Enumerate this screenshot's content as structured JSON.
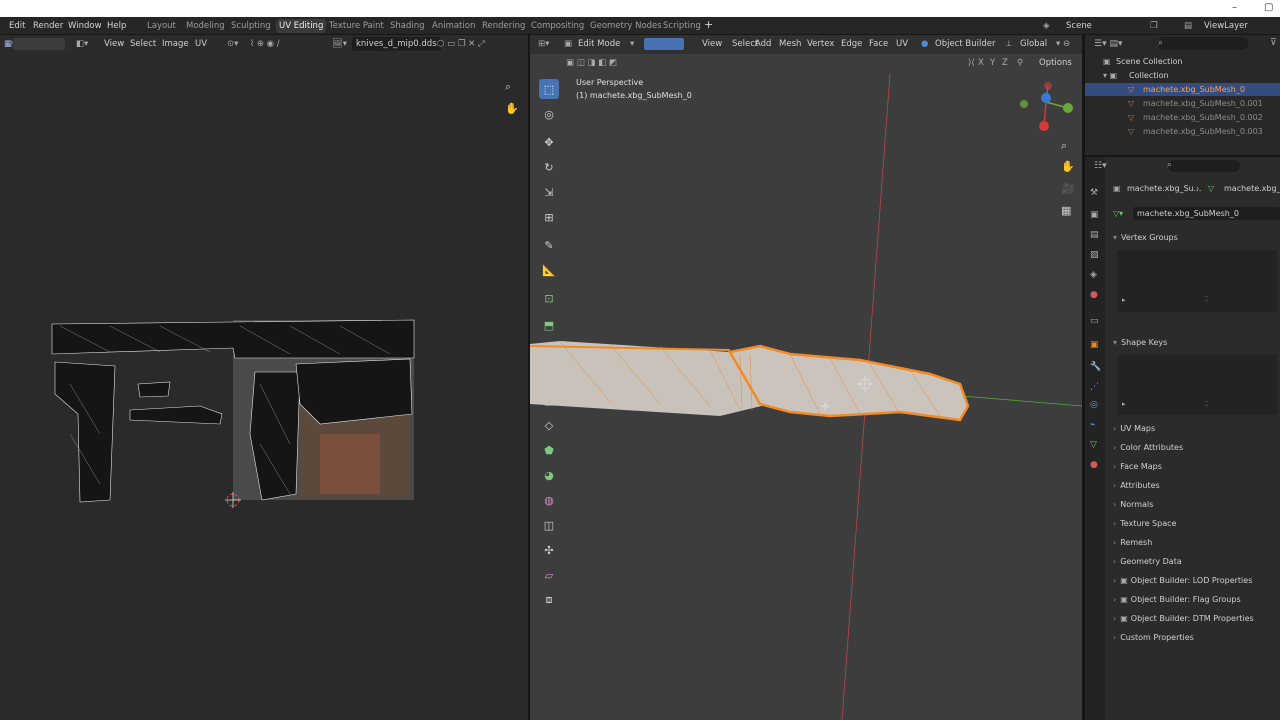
{
  "menus": [
    "Edit",
    "Render",
    "Window",
    "Help"
  ],
  "workspaces": [
    "Layout",
    "Modeling",
    "Sculpting",
    "UV Editing",
    "Texture Paint",
    "Shading",
    "Animation",
    "Rendering",
    "Compositing",
    "Geometry Nodes",
    "Scripting"
  ],
  "active_workspace": "UV Editing",
  "scene": {
    "label": "Scene"
  },
  "view_layer": {
    "label": "ViewLayer"
  },
  "uv_editor": {
    "menus": [
      "View",
      "Select",
      "Image",
      "UV"
    ],
    "image_name": "knives_d_mip0.dds"
  },
  "viewport": {
    "mode": "Edit Mode",
    "menus": [
      "View",
      "Select",
      "Add",
      "Mesh",
      "Vertex",
      "Edge",
      "Face",
      "UV"
    ],
    "object_builder": "Object Builder",
    "orientation": "Global",
    "options_label": "Options",
    "view_name": "User Perspective",
    "object_name": "(1) machete.xbg_SubMesh_0",
    "axes": [
      "X",
      "Y",
      "Z"
    ]
  },
  "outliner": {
    "scene_collection": "Scene Collection",
    "collection": "Collection",
    "items": [
      "machete.xbg_SubMesh_0",
      "machete.xbg_SubMesh_0.001",
      "machete.xbg_SubMesh_0.002",
      "machete.xbg_SubMesh_0.003"
    ]
  },
  "properties": {
    "breadcrumb_object": "machete.xbg_Su...",
    "breadcrumb_data": "machete.xbg_S",
    "mesh_name": "machete.xbg_SubMesh_0",
    "vertex_groups": "Vertex Groups",
    "shape_keys": "Shape Keys",
    "panels": [
      "UV Maps",
      "Color Attributes",
      "Face Maps",
      "Attributes",
      "Normals",
      "Texture Space",
      "Remesh",
      "Geometry Data",
      "Object Builder: LOD Properties",
      "Object Builder: Flag Groups",
      "Object Builder: DTM Properties",
      "Custom Properties"
    ]
  },
  "colors": {
    "accent": "#4772b3",
    "selection": "#f28a26",
    "x_axis": "#d43a3a",
    "y_axis": "#6aa83a"
  }
}
